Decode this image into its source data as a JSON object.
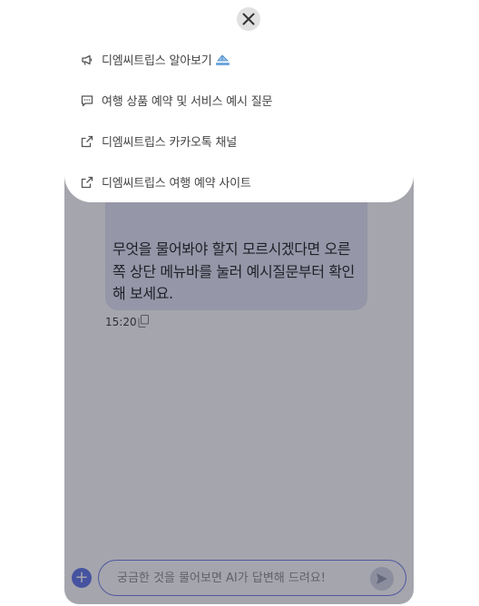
{
  "menu": {
    "items": [
      {
        "label": "디엠씨트립스 알아보기",
        "icon": "megaphone-icon"
      },
      {
        "label": "여행 상품 예약 및 서비스 예시 질문",
        "icon": "chat-bubble-icon"
      },
      {
        "label": "디엠씨트립스 카카오톡 채널",
        "icon": "external-link-icon"
      },
      {
        "label": "디엠씨트립스 여행 예약 사이트",
        "icon": "external-link-icon"
      }
    ],
    "close_icon": "close-icon"
  },
  "chat": {
    "message": "무엇을 물어봐야 할지 모르시겠다면 오른쪽 상단 메뉴바를 눌러 예시질문부터 확인해 보세요.",
    "time": "15:20"
  },
  "input": {
    "placeholder": "궁금한 것을 물어보면 AI가 답변해 드려요!"
  },
  "colors": {
    "accent": "#5b73e8",
    "bubble": "#e4e6f5",
    "overlay": "#28283c"
  }
}
